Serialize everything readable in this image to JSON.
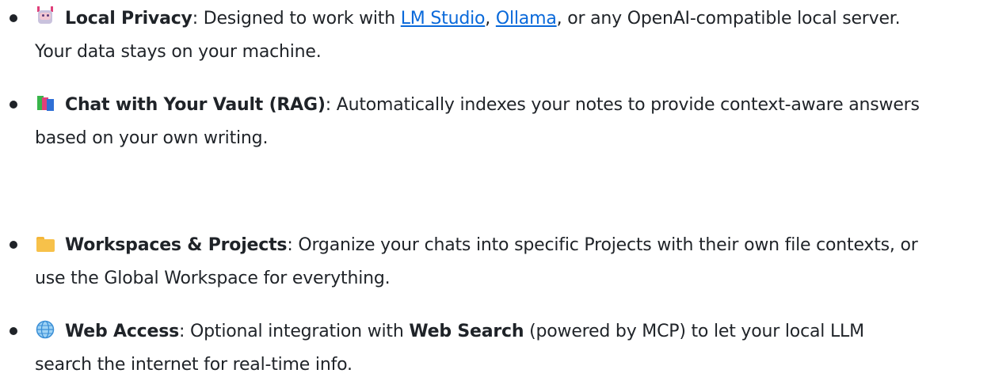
{
  "items": [
    {
      "icon": "robot-icon",
      "title": "Local Privacy",
      "line1": [
        ": Designed to work with ",
        "LM Studio",
        ", ",
        "Ollama",
        ", or any OpenAI-compatible local server."
      ],
      "line2": "Your data stays on your machine."
    },
    {
      "icon": "books-icon",
      "title": "Chat with Your Vault (RAG)",
      "line1": [
        ": Automatically indexes your notes to provide context-aware answers"
      ],
      "line2": "based on your own writing."
    },
    {
      "icon": "folder-icon",
      "title": "Workspaces & Projects",
      "line1": [
        ": Organize your chats into specific Projects with their own file contexts, or"
      ],
      "line2": "use the Global Workspace for everything."
    },
    {
      "icon": "globe-icon",
      "title": "Web Access",
      "line1": [
        ": Optional integration with ",
        "Web Search",
        " (powered by MCP) to let your local LLM"
      ],
      "line2": "search the internet for real-time info."
    }
  ],
  "colors": {
    "text": "#1f2328",
    "link": "#0969da"
  }
}
